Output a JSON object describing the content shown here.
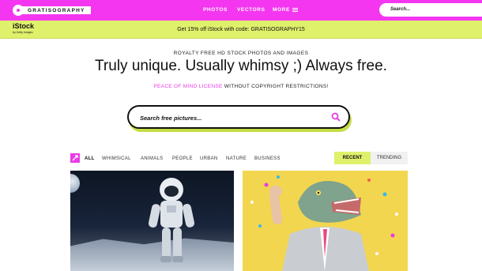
{
  "topbar": {
    "logo_text": "GRATISOGRAPHY",
    "nav": {
      "photos": "PHOTOS",
      "vectors": "VECTORS",
      "more": "MORE"
    },
    "search_placeholder": "Search..."
  },
  "promo": {
    "istock_logo": "iStock",
    "istock_sub": "by Getty Images",
    "text": "Get 15% off iStock with code: GRATISOGRAPHY15"
  },
  "hero": {
    "subtitle": "ROYALTY FREE HD STOCK PHOTOS AND IMAGES",
    "title": "Truly unique. Usually whimsy ;) Always free.",
    "license_link": "PEACE OF MIND LICENSE",
    "license_rest": " WITHOUT COPYRIGHT RESTRICTIONS!",
    "search_placeholder": "Search free pictures..."
  },
  "filters": {
    "categories": [
      "ALL",
      "WHIMSICAL",
      "ANIMALS",
      "PEOPLE",
      "URBAN",
      "NATURE",
      "BUSINESS"
    ],
    "sort_tabs": [
      "RECENT",
      "TRENDING"
    ],
    "active_sort": "RECENT"
  },
  "colors": {
    "brand_pink": "#f536f0",
    "accent_lime": "#dff06b"
  },
  "icons": {
    "menu": "hamburger-icon",
    "search": "search-icon",
    "filter": "shuffle-icon"
  }
}
